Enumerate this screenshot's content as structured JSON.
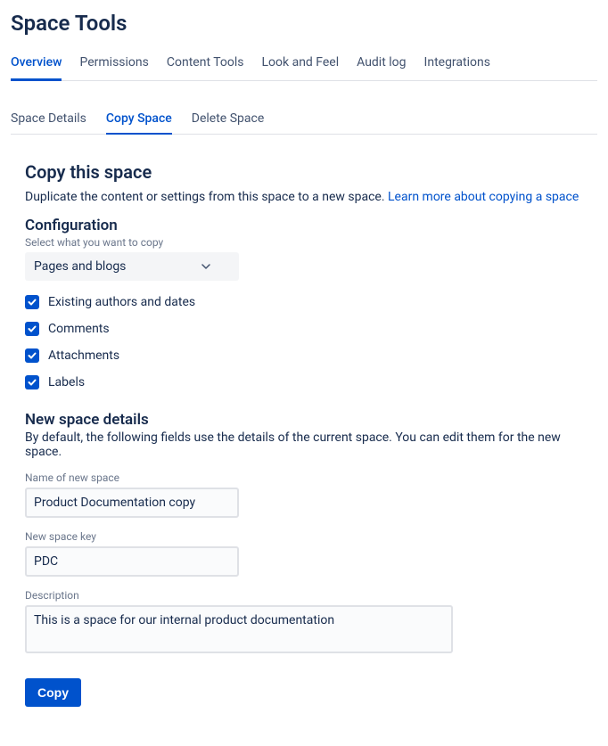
{
  "page_title": "Space Tools",
  "tabs_primary": [
    {
      "label": "Overview",
      "active": true
    },
    {
      "label": "Permissions",
      "active": false
    },
    {
      "label": "Content Tools",
      "active": false
    },
    {
      "label": "Look and Feel",
      "active": false
    },
    {
      "label": "Audit log",
      "active": false
    },
    {
      "label": "Integrations",
      "active": false
    }
  ],
  "tabs_secondary": [
    {
      "label": "Space Details",
      "active": false
    },
    {
      "label": "Copy Space",
      "active": true
    },
    {
      "label": "Delete Space",
      "active": false
    }
  ],
  "copy": {
    "heading": "Copy this space",
    "description_pre": "Duplicate the content or settings from this space to a new space. ",
    "learn_more": "Learn more about copying a space",
    "config_heading": "Configuration",
    "config_hint": "Select what you want to copy",
    "select_value": "Pages and blogs",
    "checkboxes": [
      {
        "label": "Existing authors and dates",
        "checked": true
      },
      {
        "label": "Comments",
        "checked": true
      },
      {
        "label": "Attachments",
        "checked": true
      },
      {
        "label": "Labels",
        "checked": true
      }
    ],
    "details_heading": "New space details",
    "details_description": "By default, the following fields use the details of the current space. You can edit them for the new space.",
    "fields": {
      "name_label": "Name of new space",
      "name_value": "Product Documentation copy",
      "key_label": "New space key",
      "key_value": "PDC",
      "desc_label": "Description",
      "desc_value": "This is a space for our internal product documentation"
    },
    "submit_label": "Copy"
  }
}
